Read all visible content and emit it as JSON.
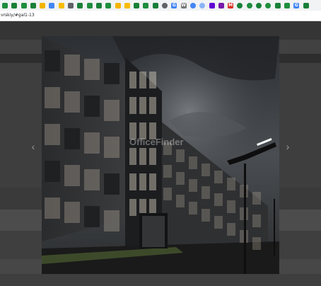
{
  "bookmarks": [
    {
      "icon": "sheets-icon",
      "color": "#1e8e3e",
      "glyph": ""
    },
    {
      "icon": "sheets-icon",
      "color": "#188038",
      "glyph": ""
    },
    {
      "icon": "sheets-icon",
      "color": "#1e8e3e",
      "glyph": ""
    },
    {
      "icon": "sheets-icon",
      "color": "#188038",
      "glyph": ""
    },
    {
      "icon": "chart-icon",
      "color": "#f4b400",
      "glyph": ""
    },
    {
      "icon": "bookmark-icon",
      "color": "#4285f4",
      "glyph": ""
    },
    {
      "icon": "drive-icon",
      "color": "#fbbc04",
      "glyph": ""
    },
    {
      "icon": "link-icon",
      "color": "#5f6368",
      "glyph": ""
    },
    {
      "icon": "sheets-icon",
      "color": "#188038",
      "glyph": ""
    },
    {
      "icon": "sheets-icon",
      "color": "#1e8e3e",
      "glyph": ""
    },
    {
      "icon": "sheets-icon",
      "color": "#188038",
      "glyph": ""
    },
    {
      "icon": "sheets-icon",
      "color": "#1e8e3e",
      "glyph": ""
    },
    {
      "icon": "slides-icon",
      "color": "#f4b400",
      "glyph": ""
    },
    {
      "icon": "slides-icon",
      "color": "#fbbc04",
      "glyph": ""
    },
    {
      "icon": "sheets-icon",
      "color": "#188038",
      "glyph": ""
    },
    {
      "icon": "sheets-icon",
      "color": "#1e8e3e",
      "glyph": ""
    },
    {
      "icon": "sheets-icon",
      "color": "#188038",
      "glyph": ""
    },
    {
      "icon": "chrome-icon",
      "color": "#5f6368",
      "glyph": ""
    },
    {
      "icon": "google-icon",
      "color": "#4285f4",
      "glyph": "G"
    },
    {
      "icon": "wikipedia-icon",
      "color": "#777777",
      "glyph": "W"
    },
    {
      "icon": "planet-icon",
      "color": "#4285f4",
      "glyph": ""
    },
    {
      "icon": "globe-icon",
      "color": "#8ab4f8",
      "glyph": ""
    },
    {
      "icon": "yahoo-icon",
      "color": "#6001d2",
      "glyph": ""
    },
    {
      "icon": "onenote-icon",
      "color": "#7719aa",
      "glyph": ""
    },
    {
      "icon": "gmail-icon",
      "color": "#d93025",
      "glyph": "M"
    },
    {
      "icon": "ring-icon",
      "color": "#188038",
      "glyph": ""
    },
    {
      "icon": "ring-icon",
      "color": "#1e8e3e",
      "glyph": ""
    },
    {
      "icon": "ring-icon",
      "color": "#188038",
      "glyph": ""
    },
    {
      "icon": "ring-icon",
      "color": "#1e8e3e",
      "glyph": ""
    },
    {
      "icon": "sheets-icon",
      "color": "#188038",
      "glyph": ""
    },
    {
      "icon": "sheets-icon",
      "color": "#1e8e3e",
      "glyph": ""
    },
    {
      "icon": "google-icon",
      "color": "#4285f4",
      "glyph": "G"
    },
    {
      "icon": "sheets-icon",
      "color": "#188038",
      "glyph": ""
    }
  ],
  "address_bar": {
    "url": "vrskiy/#gal1-13"
  },
  "site_menu": [
    "",
    "",
    "",
    ""
  ],
  "gallery": {
    "image_alt": "",
    "watermark": "OfficeFinder",
    "prev_icon": "‹",
    "next_icon": "›"
  },
  "colors": {
    "overlay": "#4a4a4a",
    "bars": "#353535",
    "sky": "#3b3e41",
    "facade": "#2b2c2e",
    "window_lit": "#b9b0a0",
    "lamp_light": "#ffffff"
  }
}
